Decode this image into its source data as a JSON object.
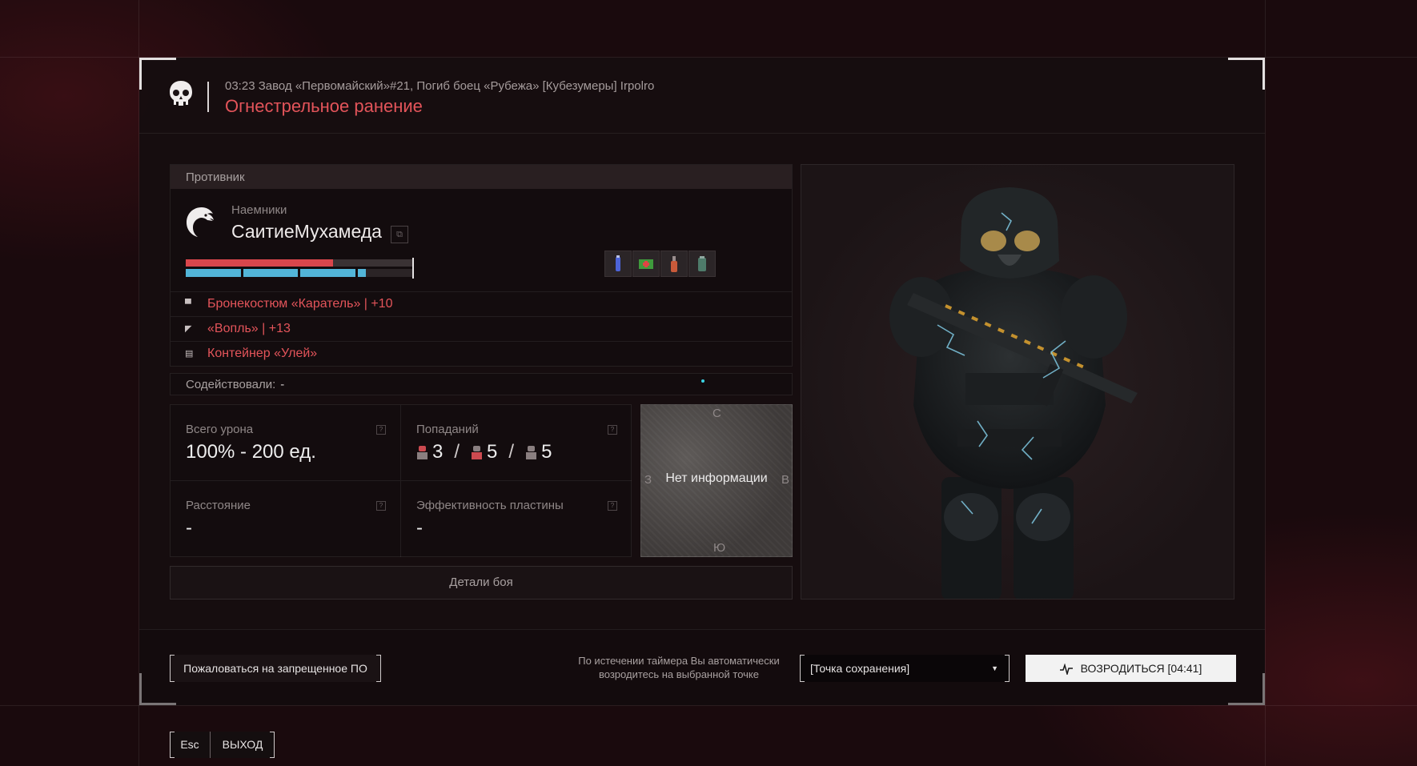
{
  "header": {
    "kill_info": "03:23 Завод «Первомайский»#21, Погиб боец «Рубежа» [Кубезумеры] Irpolro",
    "cause": "Огнестрельное ранение"
  },
  "enemy": {
    "section_title": "Противник",
    "faction": "Наемники",
    "player_name": "СаитиеМухамеда",
    "health_fraction": 0.65,
    "armor_segments": [
      1.0,
      1.0,
      1.0,
      0.15
    ],
    "loot_icons": [
      "syringe-icon",
      "medkit-icon",
      "bottle-icon",
      "canister-icon"
    ],
    "equipment": [
      {
        "icon": "armor-icon",
        "label": "Бронекостюм «Каратель» | +10"
      },
      {
        "icon": "gun-icon",
        "label": "«Вопль» | +13"
      },
      {
        "icon": "container-icon",
        "label": "Контейнер «Улей»"
      }
    ]
  },
  "assist": {
    "label": "Содействовали:",
    "value": "-"
  },
  "stats": {
    "total_damage": {
      "label": "Всего урона",
      "value": "100% - 200 ед."
    },
    "hits": {
      "label": "Попаданий",
      "head": "3",
      "body": "5",
      "legs": "5"
    },
    "distance": {
      "label": "Расстояние",
      "value": "-"
    },
    "plate_efficiency": {
      "label": "Эффективность пластины",
      "value": "-"
    }
  },
  "minimap": {
    "north": "С",
    "south": "Ю",
    "west": "З",
    "east": "В",
    "message": "Нет информации"
  },
  "details_button": "Детали боя",
  "footer": {
    "report_button": "Пожаловаться на запрещенное ПО",
    "timer_note_line1": "По истечении таймера Вы автоматически",
    "timer_note_line2": "возродитесь на выбранной точке",
    "spawn_point": "[Точка сохранения]",
    "respawn_button": "ВОЗРОДИТЬСЯ [04:41]"
  },
  "exit": {
    "key": "Esc",
    "label": "ВЫХОД"
  },
  "colors": {
    "accent_red": "#e3545a",
    "health_red": "#d9464c",
    "armor_blue": "#52b5d8"
  }
}
